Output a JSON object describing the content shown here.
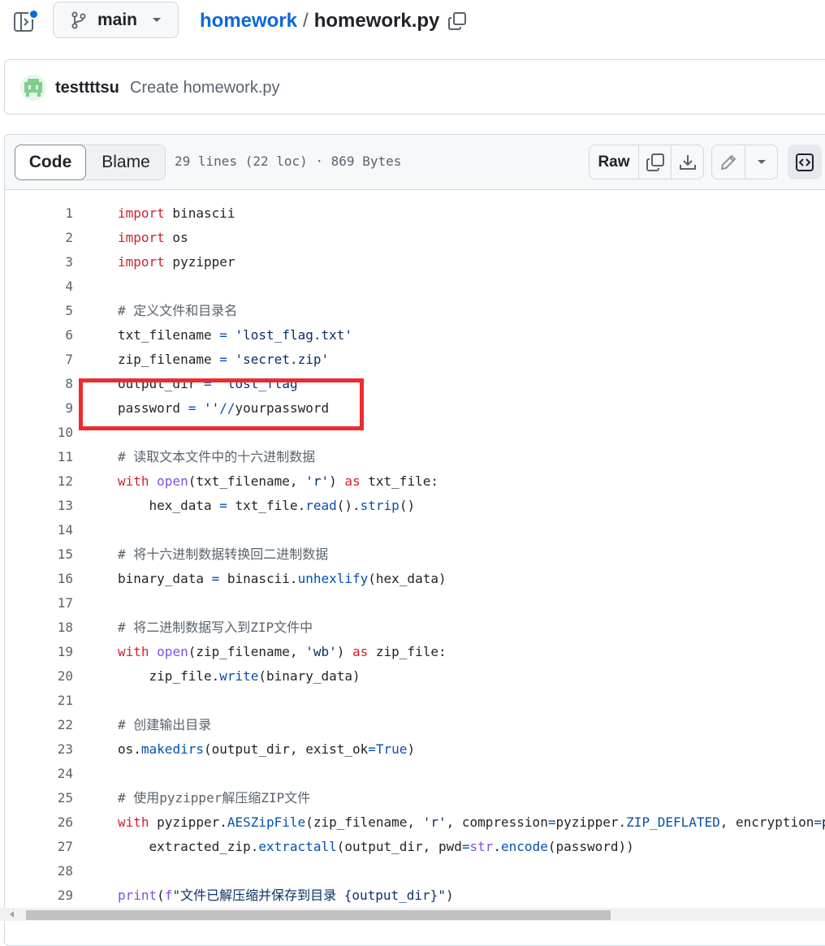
{
  "header": {
    "branch": "main",
    "repo": "homework",
    "separator": "/",
    "file": "homework.py"
  },
  "commit": {
    "author": "testtttsu",
    "message": "Create homework.py"
  },
  "file_toolbar": {
    "code_tab": "Code",
    "blame_tab": "Blame",
    "info": "29 lines (22 loc) · 869 Bytes",
    "raw_label": "Raw"
  },
  "code": {
    "lines": [
      "import binascii",
      "import os",
      "import pyzipper",
      "",
      "# 定义文件和目录名",
      "txt_filename = 'lost_flag.txt'",
      "zip_filename = 'secret.zip'",
      "output_dir = 'lost_flag'",
      "password = ''//yourpassword",
      "",
      "# 读取文本文件中的十六进制数据",
      "with open(txt_filename, 'r') as txt_file:",
      "    hex_data = txt_file.read().strip()",
      "",
      "# 将十六进制数据转换回二进制数据",
      "binary_data = binascii.unhexlify(hex_data)",
      "",
      "# 将二进制数据写入到ZIP文件中",
      "with open(zip_filename, 'wb') as zip_file:",
      "    zip_file.write(binary_data)",
      "",
      "# 创建输出目录",
      "os.makedirs(output_dir, exist_ok=True)",
      "",
      "# 使用pyzipper解压缩ZIP文件",
      "with pyzipper.AESZipFile(zip_filename, 'r', compression=pyzipper.ZIP_DEFLATED, encryption=pyzipper.WZ_AES) as extracted_zip:",
      "    extracted_zip.extractall(output_dir, pwd=str.encode(password))",
      "",
      "print(f\"文件已解压缩并保存到目录 {output_dir}\")"
    ]
  },
  "colors": {
    "keyword": "#cf222e",
    "function": "#8250df",
    "string": "#0a3069",
    "comment": "#59636e",
    "builtin": "#0550ae",
    "link": "#0969da",
    "highlight_box": "#ee2a2e"
  }
}
